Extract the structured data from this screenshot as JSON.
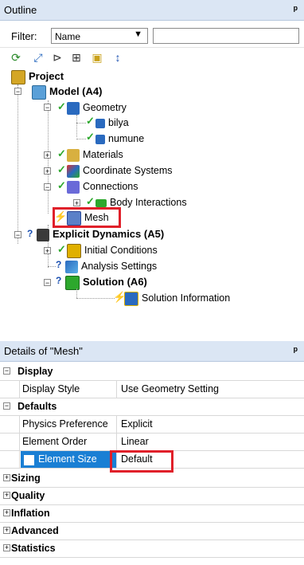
{
  "outline": {
    "title": "Outline",
    "pin": "ᵖ",
    "filter_label": "Filter:",
    "filter_value": "Name",
    "toolbar_icons": [
      "refresh-icon",
      "expand-all-icon",
      "collapse-icon",
      "plus-box-icon",
      "folder-icon",
      "sort-az-icon"
    ]
  },
  "tree": {
    "project": "Project",
    "model": "Model (A4)",
    "geometry": "Geometry",
    "bilya": "bilya",
    "numune": "numune",
    "materials": "Materials",
    "coordinate_systems": "Coordinate Systems",
    "connections": "Connections",
    "body_interactions": "Body Interactions",
    "mesh": "Mesh",
    "explicit_dynamics": "Explicit Dynamics (A5)",
    "initial_conditions": "Initial Conditions",
    "analysis_settings": "Analysis Settings",
    "solution": "Solution (A6)",
    "solution_information": "Solution Information"
  },
  "details": {
    "title": "Details of \"Mesh\"",
    "pin": "ᵖ",
    "display": "Display",
    "display_style_label": "Display Style",
    "display_style_value": "Use Geometry Setting",
    "defaults": "Defaults",
    "physics_pref_label": "Physics Preference",
    "physics_pref_value": "Explicit",
    "element_order_label": "Element Order",
    "element_order_value": "Linear",
    "element_size_label": "Element Size",
    "element_size_value": "Default",
    "sizing": "Sizing",
    "quality": "Quality",
    "inflation": "Inflation",
    "advanced": "Advanced",
    "statistics": "Statistics"
  },
  "colors": {
    "header_bg": "#dbe6f4",
    "selection_blue": "#1a7fd4",
    "highlight_red": "#e0202a",
    "check_green": "#2da82d"
  }
}
